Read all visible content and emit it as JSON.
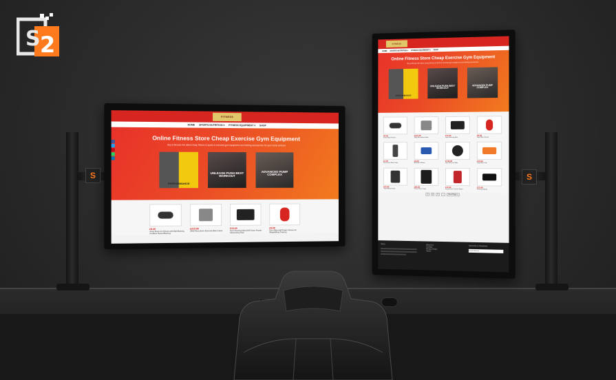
{
  "colors": {
    "accent": "#e8302a",
    "orange": "#f27b1e",
    "brand_yellow": "#e0c86a",
    "logo_orange": "#ff7a1c"
  },
  "logo": {
    "letter": "S",
    "digit": "2"
  },
  "bracket_glyph": "S",
  "left_screen": {
    "nav": [
      "HOME",
      "SPORTS NUTRITION ▾",
      "FITNESS EQUIPMENT ▾",
      "SHOP"
    ],
    "title": "Online Fitness Store Cheap Exercise Gym Equipment",
    "subtitle": "Buy & Browse the latest cheap fitness & sports & exercise gym equipment and training accessories for your home workout",
    "promos": [
      {
        "text": "PERFORMANCE"
      },
      {
        "text": "UNLEASH PUSH BEST WORKOUT"
      },
      {
        "text": "ADVANCED PUMP COMPLEX"
      }
    ],
    "products": [
      {
        "price": "£8.49",
        "name": "Jump Rope for Fitness with Ball Bearing Cordless Speed Bearing"
      },
      {
        "price": "£215.98",
        "name": "JMQ Recumbent Exercise Bike Indoor"
      },
      {
        "price": "£13.49",
        "name": "Gym Flooring Mats EVA Foam Puzzle Interlocking Tiles"
      },
      {
        "price": "£8.99",
        "name": "Gym Mitts Half Finger Gloves for Weightlifting Training"
      }
    ]
  },
  "right_screen": {
    "nav": [
      "HOME",
      "SPORTS NUTRITION ▾",
      "FITNESS EQUIPMENT ▾",
      "SHOP"
    ],
    "title": "Online Fitness Store Cheap Exercise Gym Equipment",
    "subtitle": "Buy & Browse the latest cheap fitness & sports & exercise gym equipment and training accessories",
    "promos": [
      {
        "text": "PERFORMANCE"
      },
      {
        "text": "UNLEASH PUSH BEST WORKOUT"
      },
      {
        "text": "ADVANCED PUMP COMPLEX"
      }
    ],
    "products": [
      {
        "price": "£8.49",
        "name": "Jump Rope Fitness"
      },
      {
        "price": "£215.98",
        "name": "JMQ Recumbent Bike"
      },
      {
        "price": "£13.49",
        "name": "Gym Flooring Mats"
      },
      {
        "price": "£8.99",
        "name": "Gym Mitts Gloves"
      },
      {
        "price": "£4.99",
        "name": "Resistance Band Tube"
      },
      {
        "price": "£9.99",
        "name": "Ab Roller Wheel"
      },
      {
        "price": "£149.99",
        "name": "Spin Exercise Bike"
      },
      {
        "price": "£19.99",
        "name": "Yoga Block Set"
      },
      {
        "price": "£35.99",
        "name": "Tripod Ring Stand"
      },
      {
        "price": "£89.99",
        "name": "Power Rack Cage"
      },
      {
        "price": "£12.99",
        "name": "Suspension Trainer Straps"
      },
      {
        "price": "£15.99",
        "name": "Push Up Board"
      }
    ],
    "pagination": [
      "1",
      "2",
      "3",
      "→",
      "Next Page »"
    ],
    "footer": {
      "about_heading": "About",
      "links": [
        "About Us",
        "Contact",
        "Privacy Policy",
        "Terms"
      ],
      "newsletter_heading": "Subscribe to Newsletter",
      "email_placeholder": "Email address"
    }
  }
}
